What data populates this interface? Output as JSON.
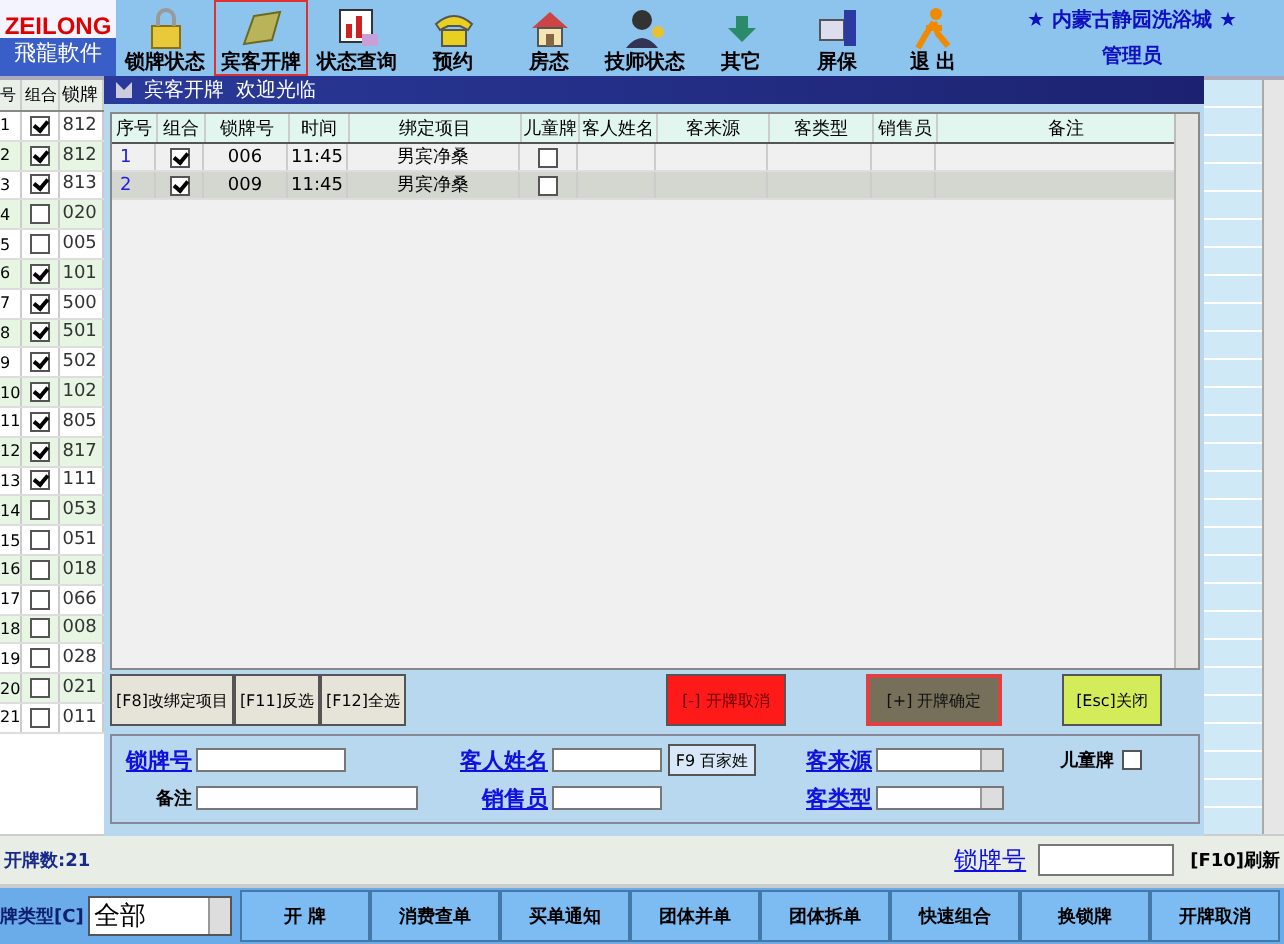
{
  "logo": {
    "name": "ZEILONG",
    "subtitle": "飛龍軟件"
  },
  "toolbar": [
    {
      "label": "锁牌状态",
      "selected": false
    },
    {
      "label": "宾客开牌",
      "selected": true
    },
    {
      "label": "状态查询",
      "selected": false
    },
    {
      "label": "预约",
      "selected": false
    },
    {
      "label": "房态",
      "selected": false
    },
    {
      "label": "技师状态",
      "selected": false
    },
    {
      "label": "其它",
      "selected": false
    },
    {
      "label": "屏保",
      "selected": false
    },
    {
      "label": "退 出",
      "selected": false
    }
  ],
  "venue": "★ 内蒙古静园洗浴城 ★",
  "user": "管理员",
  "back_table": {
    "columns": [
      "号",
      "组合",
      "锁牌"
    ],
    "rows": [
      {
        "no": "1",
        "checked": true,
        "code": "812"
      },
      {
        "no": "2",
        "checked": true,
        "code": "812"
      },
      {
        "no": "3",
        "checked": true,
        "code": "813"
      },
      {
        "no": "4",
        "checked": false,
        "code": "020"
      },
      {
        "no": "5",
        "checked": false,
        "code": "005"
      },
      {
        "no": "6",
        "checked": true,
        "code": "101"
      },
      {
        "no": "7",
        "checked": true,
        "code": "500"
      },
      {
        "no": "8",
        "checked": true,
        "code": "501"
      },
      {
        "no": "9",
        "checked": true,
        "code": "502"
      },
      {
        "no": "10",
        "checked": true,
        "code": "102"
      },
      {
        "no": "11",
        "checked": true,
        "code": "805"
      },
      {
        "no": "12",
        "checked": true,
        "code": "817"
      },
      {
        "no": "13",
        "checked": true,
        "code": "111"
      },
      {
        "no": "14",
        "checked": false,
        "code": "053"
      },
      {
        "no": "15",
        "checked": false,
        "code": "051"
      },
      {
        "no": "16",
        "checked": false,
        "code": "018"
      },
      {
        "no": "17",
        "checked": false,
        "code": "066"
      },
      {
        "no": "18",
        "checked": false,
        "code": "008"
      },
      {
        "no": "19",
        "checked": false,
        "code": "028"
      },
      {
        "no": "20",
        "checked": false,
        "code": "021"
      },
      {
        "no": "21",
        "checked": false,
        "code": "011"
      }
    ]
  },
  "dialog": {
    "title": "宾客开牌",
    "greeting": "欢迎光临",
    "table": {
      "columns": [
        "序号",
        "组合",
        "锁牌号",
        "时间",
        "绑定项目",
        "儿童牌",
        "客人姓名",
        "客来源",
        "客类型",
        "销售员",
        "备注"
      ],
      "rows": [
        {
          "index": "1",
          "checked": true,
          "code": "006",
          "time": "11:45",
          "item": "男宾净桑",
          "child": false,
          "selected": false
        },
        {
          "index": "2",
          "checked": true,
          "code": "009",
          "time": "11:45",
          "item": "男宾净桑",
          "child": false,
          "selected": true
        }
      ]
    },
    "buttons": [
      {
        "label": "[F8]改绑定项目",
        "kind": "plain",
        "highlighted": false
      },
      {
        "label": "[F11]反选",
        "kind": "plain",
        "highlighted": false
      },
      {
        "label": "[F12]全选",
        "kind": "plain",
        "highlighted": false
      },
      {
        "label": "[-] 开牌取消",
        "kind": "danger",
        "highlighted": false
      },
      {
        "label": "[+] 开牌确定",
        "kind": "confirm",
        "highlighted": true
      },
      {
        "label": "[Esc]关闭",
        "kind": "close",
        "highlighted": false
      }
    ],
    "form": [
      [
        {
          "kind": "link",
          "label": "锁牌号"
        },
        {
          "kind": "input"
        },
        {
          "kind": "link",
          "label": "客人姓名"
        },
        {
          "kind": "input"
        },
        {
          "kind": "button",
          "label": "F9 百家姓"
        },
        {
          "kind": "link",
          "label": "客来源"
        },
        {
          "kind": "select"
        },
        {
          "kind": "checkbox",
          "label": "儿童牌",
          "checked": false
        }
      ],
      [
        {
          "kind": "label",
          "label": "备注"
        },
        {
          "kind": "input"
        },
        {
          "kind": "link",
          "label": "销售员"
        },
        {
          "kind": "input"
        },
        {
          "kind": "link",
          "label": "客类型"
        },
        {
          "kind": "select"
        }
      ]
    ]
  },
  "status": {
    "count": "开牌数:21",
    "lock_label": "锁牌号",
    "refresh": "[F10]刷新"
  },
  "bottom": {
    "filter_label": "牌类型[C]",
    "filter_value": "全部",
    "buttons": [
      "开 牌",
      "消费查单",
      "买单通知",
      "团体并单",
      "团体拆单",
      "快速组合",
      "换锁牌",
      "开牌取消"
    ]
  }
}
